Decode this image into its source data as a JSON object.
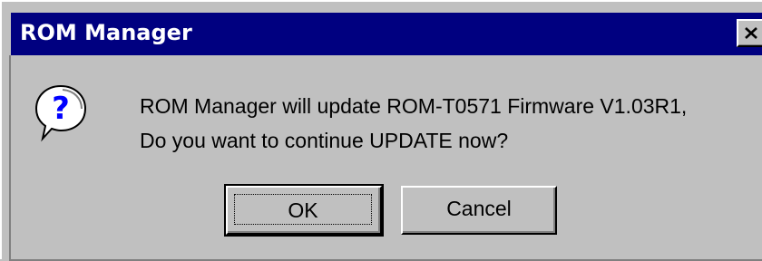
{
  "window": {
    "title": "ROM Manager",
    "close_icon": "close-icon"
  },
  "message": {
    "icon": "question-icon",
    "line1": "ROM Manager will update ROM-T0571 Firmware V1.03R1,",
    "line2": "Do you want to continue UPDATE now?"
  },
  "buttons": {
    "ok_label": "OK",
    "cancel_label": "Cancel"
  },
  "colors": {
    "titlebar": "#000080",
    "face": "#c0c0c0",
    "icon_blue": "#0000ff"
  }
}
